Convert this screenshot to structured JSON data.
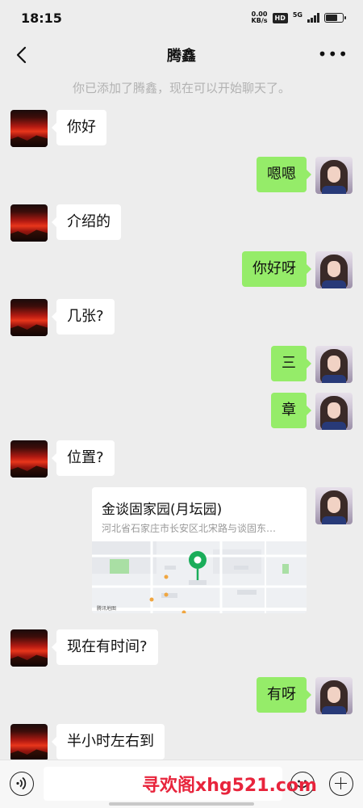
{
  "status_bar": {
    "time": "18:15",
    "net_speed_value": "0.00",
    "net_speed_unit": "KB/s",
    "hd": "HD",
    "network": "5G"
  },
  "nav": {
    "title": "腾鑫",
    "more": "•••"
  },
  "system_notice": "你已添加了腾鑫，现在可以开始聊天了。",
  "messages": [
    {
      "side": "left",
      "text": "你好"
    },
    {
      "side": "right",
      "text": "嗯嗯"
    },
    {
      "side": "left",
      "text": "介绍的"
    },
    {
      "side": "right",
      "text": "你好呀"
    },
    {
      "side": "left",
      "text": "几张?"
    },
    {
      "side": "right",
      "text": "三"
    },
    {
      "side": "right",
      "text": "章"
    },
    {
      "side": "left",
      "text": "位置?"
    },
    {
      "side": "right",
      "type": "location"
    },
    {
      "side": "left",
      "text": "现在有时间?"
    },
    {
      "side": "right",
      "text": "有呀"
    },
    {
      "side": "left",
      "text": "半小时左右到"
    }
  ],
  "location": {
    "name": "金谈固家园(月坛园)",
    "address": "河北省石家庄市长安区北宋路与谈固东…",
    "map_credit": "腾讯地图"
  },
  "input": {
    "voice_icon": "voice-icon",
    "emoji_icon": "emoji-icon",
    "plus_icon": "plus-icon"
  },
  "watermark": "寻欢阁xhg521.com",
  "colors": {
    "background": "#ededed",
    "bubble_self": "#95ec69",
    "bubble_other": "#ffffff",
    "notice": "#b2b2b2",
    "watermark": "#e8243c",
    "map_pin": "#1aad5a"
  }
}
